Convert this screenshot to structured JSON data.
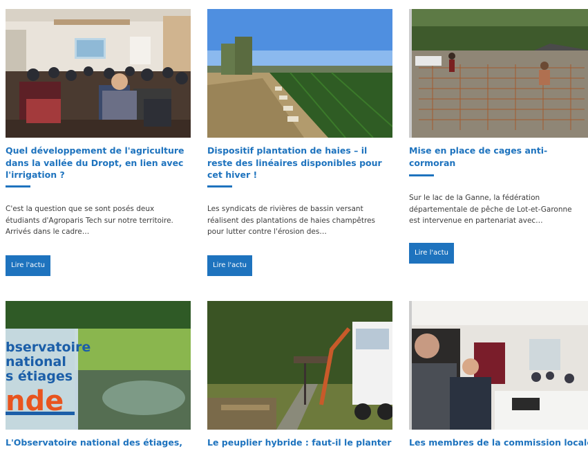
{
  "articles": [
    {
      "title": "Quel développement de l'agriculture dans la vallée du Dropt, en lien avec l'irrigation ?",
      "excerpt": "C'est la question que se sont posés deux étudiants d'Agroparis Tech sur notre territoire. Arrivés dans le cadre…",
      "button": "Lire l'actu",
      "image": "meeting-audience-photo"
    },
    {
      "title": "Dispositif plantation de haies – il reste des linéaires disponibles pour cet hiver !",
      "excerpt": "Les syndicats de rivières de bassin versant réalisent des plantations de haies champêtres pour lutter contre l'érosion des…",
      "button": "Lire l'actu",
      "image": "hedge-field-photo"
    },
    {
      "title": "Mise en place de cages anti-cormoran",
      "excerpt_lines": [
        "Sur le lac de la Ganne, la fédération",
        "départementale de pêche de Lot-et-Garonne",
        "est intervenue en partenariat avec…"
      ],
      "button": "Lire l'actu",
      "image": "cage-construction-photo"
    },
    {
      "title": "L'Observatoire national des étiages,",
      "image": "river-observatory-photo",
      "image_text": [
        "bservatoire",
        "national",
        "s étiages",
        "nde"
      ]
    },
    {
      "title": "Le peuplier hybride : faut-il le planter",
      "image": "poplar-felling-photo"
    },
    {
      "title": "Les membres de la commission locale",
      "image": "commission-meeting-photo"
    }
  ]
}
